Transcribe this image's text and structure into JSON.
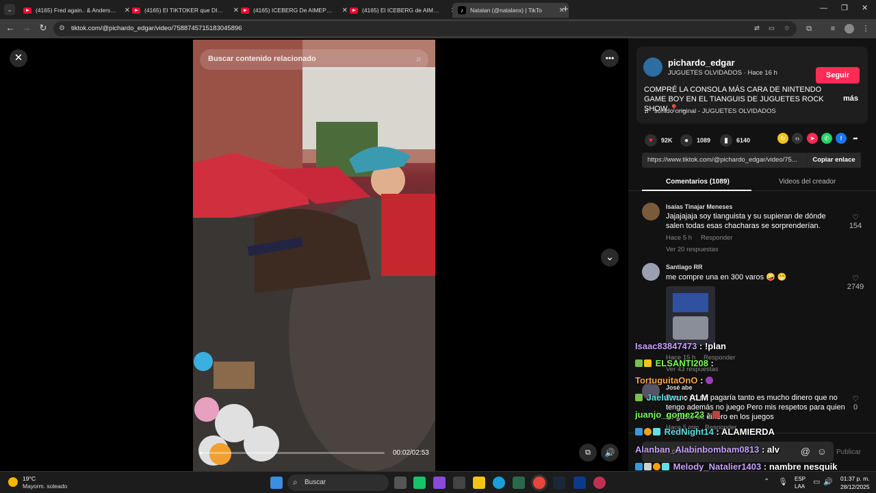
{
  "browser": {
    "tabs": [
      {
        "title": "(4165) Fred again.. & Anderson",
        "icon": "youtube-icon"
      },
      {
        "title": "(4165) El TIKTOKER que DICE S",
        "icon": "youtube-icon"
      },
      {
        "title": "(4165) ICEBERG De AIMEP3 (En",
        "icon": "youtube-icon"
      },
      {
        "title": "(4165) El ICEBERG de AIMEP3 (",
        "icon": "youtube-icon"
      },
      {
        "title": "Natalan (@natalanx) | TikTo",
        "icon": "tiktok-icon"
      }
    ],
    "url": "tiktok.com/@pichardo_edgar/video/7588745715183045896"
  },
  "video": {
    "search_placeholder": "Buscar contenido relacionado",
    "time": "00:02/02:53",
    "progress": 0.012
  },
  "post": {
    "username": "pichardo_edgar",
    "subtitle": "JUGUETES OLVIDADOS",
    "time_ago": "· Hace 16 h",
    "follow_label": "Seguir",
    "description": "COMPRÉ LA CONSOLA MÁS CARA DE NINTENDO GAME BOY EN EL TIANGUIS DE JUGUETES ROCK SHOW 📍...",
    "more_label": "más",
    "sound": "sonido original - JUGUETES OLVIDADOS",
    "likes": "92K",
    "comments": "1089",
    "saves": "6140",
    "link": "https://www.tiktok.com/@pichardo_edgar/video/75...",
    "copy_label": "Copiar enlace",
    "tab_comments": "Comentarios (1089)",
    "tab_creator": "Videos del creador"
  },
  "comments": [
    {
      "name": "Isaías Tinajar Meneses",
      "text": "Jajajajaja soy tianguista y su supieran de dónde salen todas esas chacharas se sorprenderían.",
      "time": "Hace 5 h",
      "reply": "Responder",
      "replies": "Ver 20 respuestas",
      "likes": "154"
    },
    {
      "name": "Santiago RR",
      "text": "me compre una en 300 varos 🤪 😁",
      "time": "Hace 15 h",
      "reply": "Responder",
      "replies": "Ver 43 respuestas",
      "likes": "2749"
    },
    {
      "name": "José abe",
      "text": "Bueno yo no pagaría tanto es mucho dinero que no tengo además no juego Pero mis respetos para quien se gaste su dinero en los juegos",
      "time": "Hace 5 min",
      "reply": "Responder",
      "likes": "0"
    }
  ],
  "comment_input": {
    "placeholder": "Añadir comentario...",
    "publish": "Publicar"
  },
  "chat": [
    {
      "user": "Isaac83847473",
      "msg": "!plan",
      "color": "#c8a2ff"
    },
    {
      "user": "ELSANTI208",
      "msg": "",
      "color": "#7cff5a"
    },
    {
      "user": "TortuguitaOnO",
      "msg": "",
      "color": "#ffa64d"
    },
    {
      "user": "Jaeluwu",
      "msg": "ALM",
      "color": "#5ce1e6"
    },
    {
      "user": "juanjo_gomez23",
      "msg": "",
      "color": "#7cff5a"
    },
    {
      "user": "RedNight14",
      "msg": "ALAMIERDA",
      "color": "#5ce1e6"
    },
    {
      "user": "Alanban_Alabinbombam0813",
      "msg": "alv",
      "color": "#c8a2ff"
    },
    {
      "user": "Melody_Natalier1403",
      "msg": "nambre nesquik",
      "color": "#c8a2ff"
    }
  ],
  "taskbar": {
    "weather_temp": "19°C",
    "weather_desc": "Mayorm. soleado",
    "search": "Buscar",
    "lang1": "ESP",
    "lang2": "LAA",
    "time": "01:37 p. m.",
    "date": "28/12/2025"
  }
}
